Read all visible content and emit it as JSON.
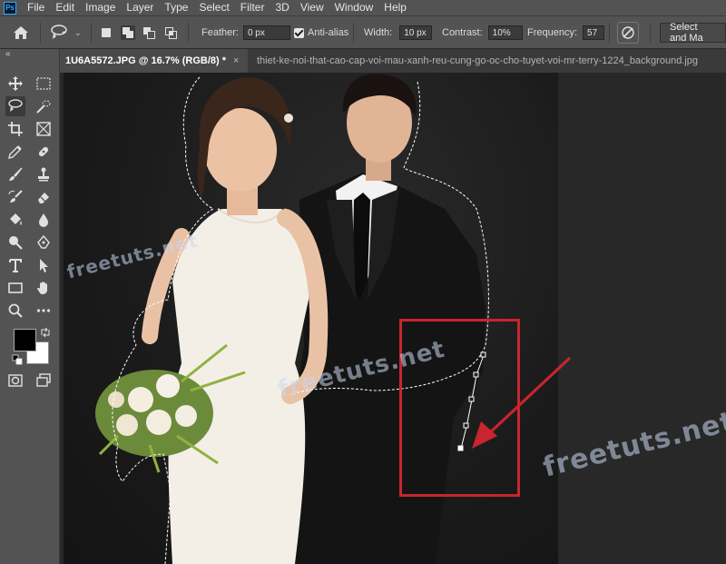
{
  "app": {
    "logo_text": "Ps"
  },
  "menu": [
    "File",
    "Edit",
    "Image",
    "Layer",
    "Type",
    "Select",
    "Filter",
    "3D",
    "View",
    "Window",
    "Help"
  ],
  "options": {
    "feather_label": "Feather:",
    "feather_value": "0 px",
    "antialias_label": "Anti-alias",
    "width_label": "Width:",
    "width_value": "10 px",
    "contrast_label": "Contrast:",
    "contrast_value": "10%",
    "frequency_label": "Frequency:",
    "frequency_value": "57",
    "select_mask_label": "Select and Ma"
  },
  "tabs": [
    {
      "label": "1U6A5572.JPG @ 16.7% (RGB/8) *",
      "close": "×"
    },
    {
      "label": "thiet-ke-noi-that-cao-cap-voi-mau-xanh-reu-cung-go-oc-cho-tuyet-voi-mr-terry-1224_background.jpg"
    }
  ],
  "toolbar": {
    "collapse": "«"
  },
  "icons": [
    "home-icon",
    "magnetic-lasso-icon",
    "move-icon",
    "marquee-icon",
    "crop-icon",
    "frame-icon",
    "eyedropper-icon",
    "healing-brush-icon",
    "brush-icon",
    "clone-stamp-icon",
    "history-brush-icon",
    "eraser-icon",
    "paint-bucket-icon",
    "blur-icon",
    "dodge-icon",
    "pen-icon",
    "type-icon",
    "path-selection-icon",
    "rectangle-icon",
    "hand-icon",
    "zoom-icon",
    "more-tools-icon",
    "quick-mask-icon",
    "screen-mode-icon"
  ],
  "colors": {
    "foreground": "#000000",
    "background": "#ffffff",
    "annotation": "#c8252f"
  },
  "watermark": "freetuts.net"
}
